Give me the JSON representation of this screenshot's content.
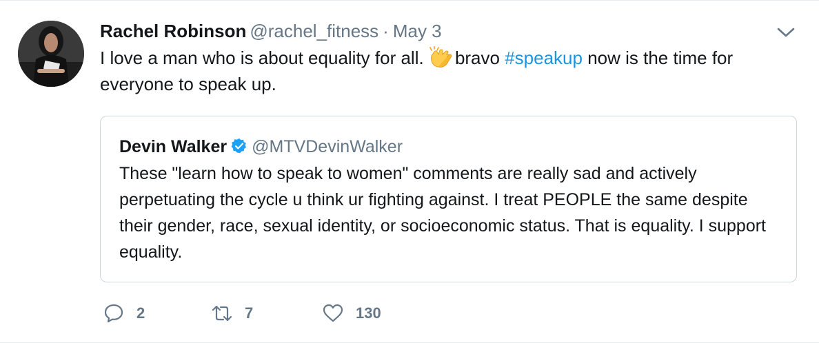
{
  "tweet": {
    "author_name": "Rachel Robinson",
    "author_handle": "@rachel_fitness",
    "separator": "·",
    "date": "May 3",
    "text_part1": "I love a man who is about equality for all. ",
    "emoji": "clapping-hands",
    "text_part2": "bravo ",
    "hashtag": "#speakup",
    "text_part3": " now is the time for everyone to speak up."
  },
  "quoted_tweet": {
    "author_name": "Devin Walker",
    "verified": true,
    "author_handle": "@MTVDevinWalker",
    "text": "These \"learn how to speak to women\" comments are really sad and actively perpetuating the cycle u think ur fighting against. I treat PEOPLE the same despite their gender, race, sexual identity, or socioeconomic status. That is equality. I support equality."
  },
  "actions": {
    "reply_count": "2",
    "retweet_count": "7",
    "like_count": "130"
  },
  "colors": {
    "link": "#1b95e0",
    "muted": "#657786",
    "border": "#ccd6dd",
    "verified": "#1da1f2"
  }
}
